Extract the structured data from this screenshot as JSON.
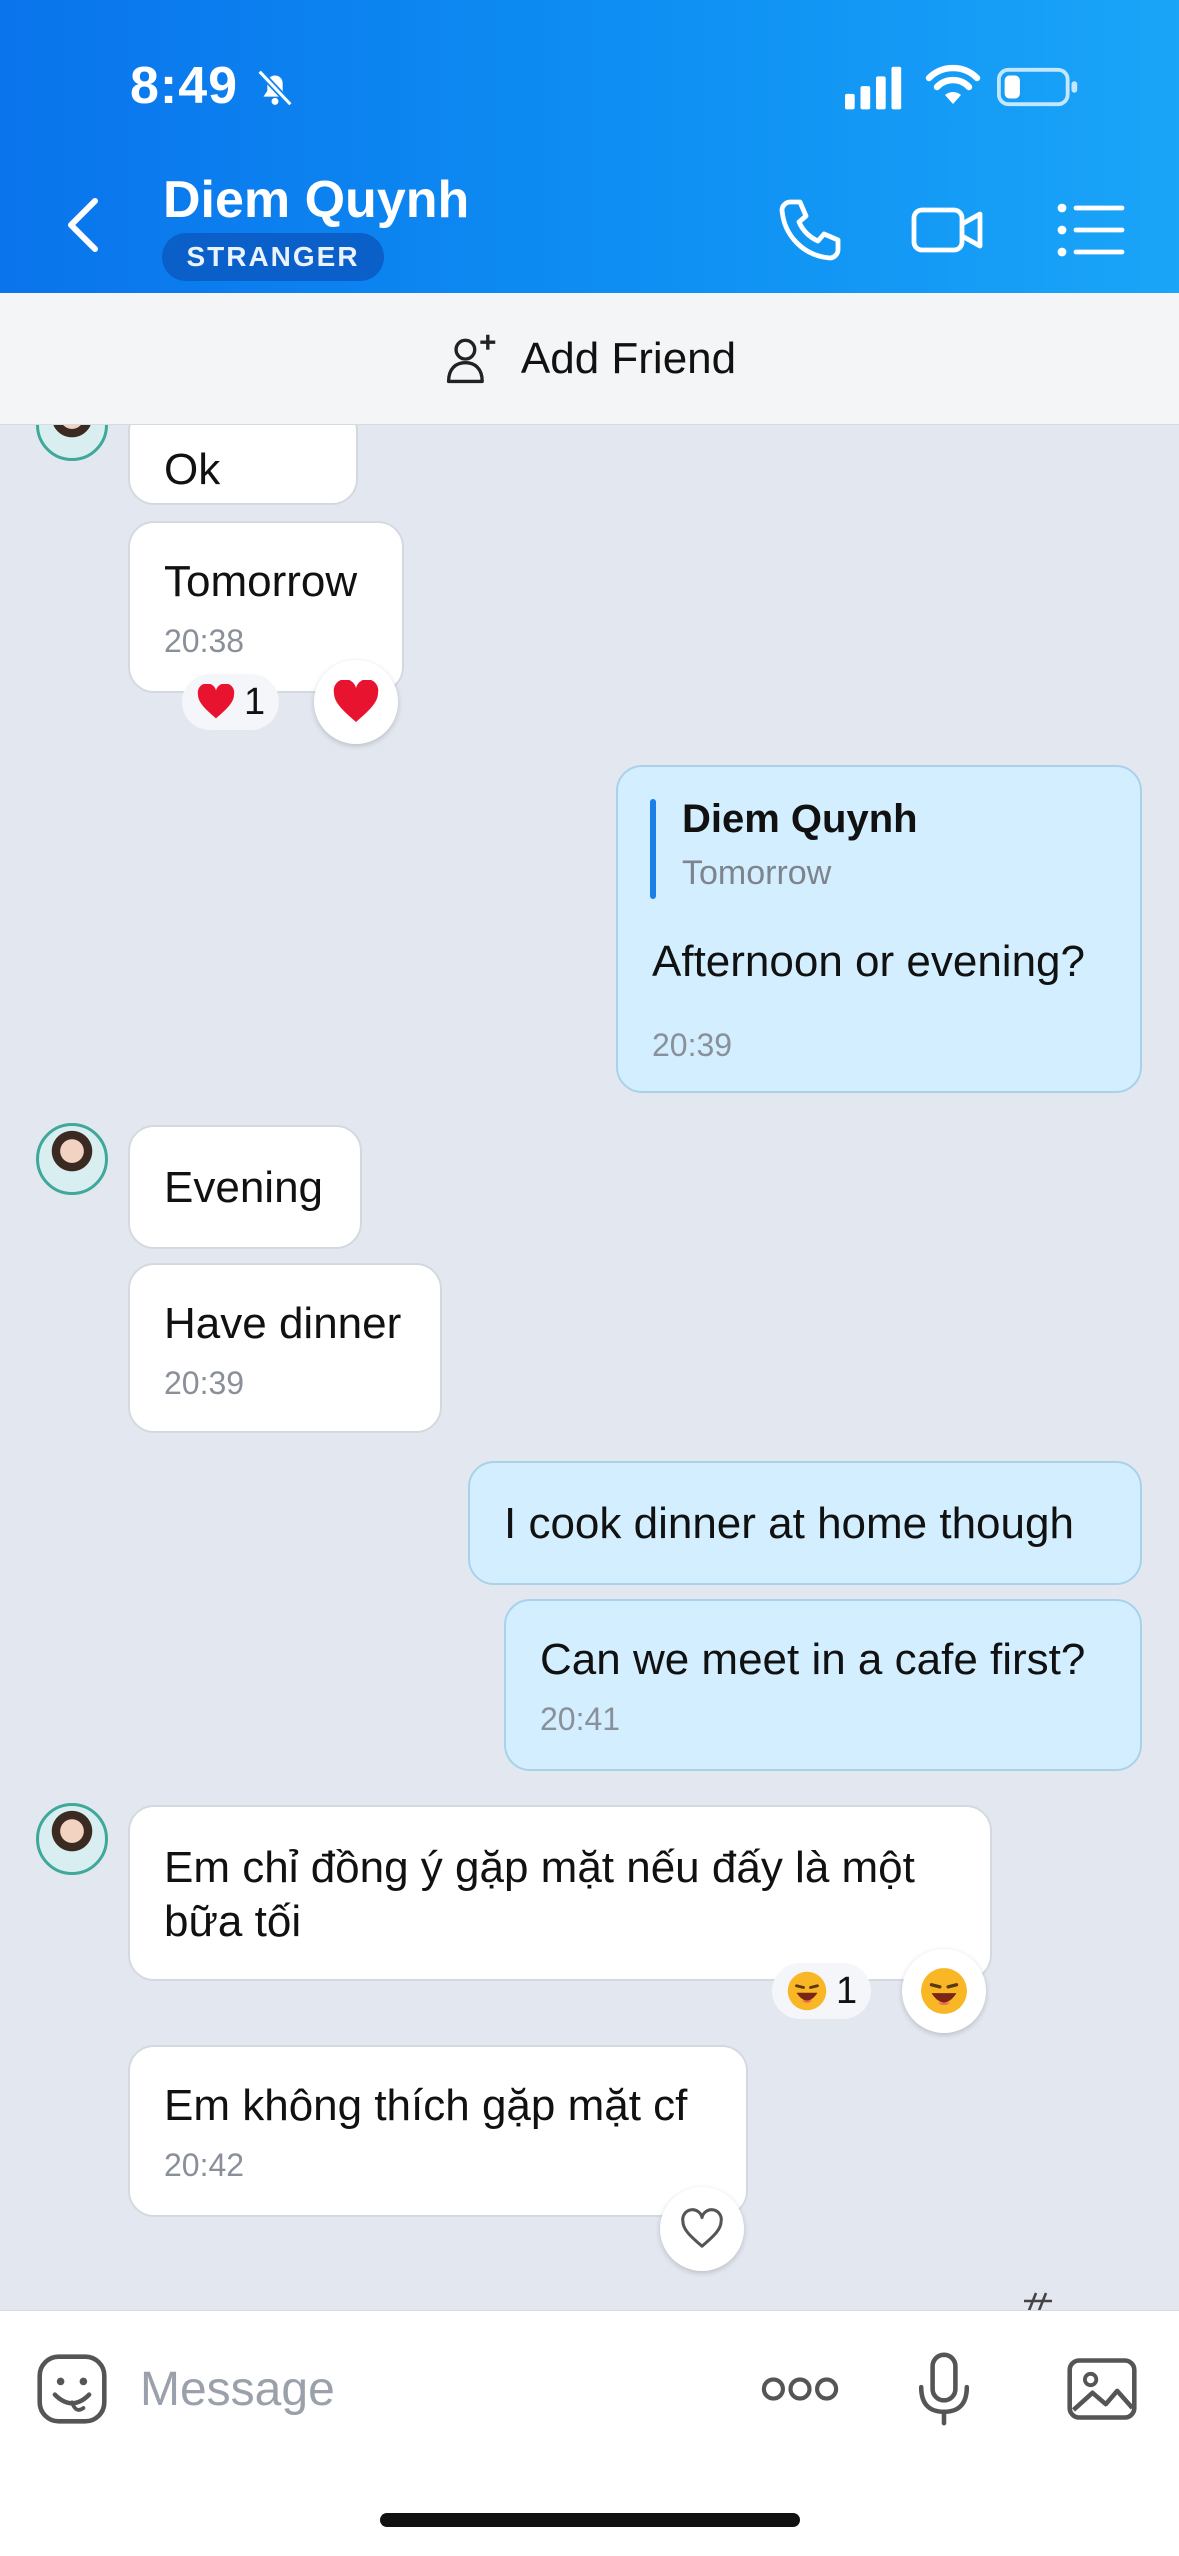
{
  "status_bar": {
    "time": "8:49"
  },
  "header": {
    "contact_name": "Diem Quynh",
    "badge": "STRANGER"
  },
  "friend_bar": {
    "label": "Add Friend"
  },
  "messages": [
    {
      "text": "Ok"
    },
    {
      "text": "Tomorrow",
      "time": "20:38",
      "reaction_count": "1"
    },
    {
      "reply_name": "Diem Quynh",
      "reply_text": "Tomorrow",
      "text": "Afternoon or evening?",
      "time": "20:39"
    },
    {
      "text": "Evening"
    },
    {
      "text": "Have dinner",
      "time": "20:39"
    },
    {
      "text": "I cook dinner at home though"
    },
    {
      "text": "Can we meet in a cafe first?",
      "time": "20:41"
    },
    {
      "text": "Em chỉ đồng ý gặp mặt nếu đấy là một bữa tối",
      "reaction_count": "1"
    },
    {
      "text": "Em không thích gặp mặt cf",
      "time": "20:42"
    }
  ],
  "composer": {
    "placeholder": "Message"
  },
  "colors": {
    "header_blue": "#0a74ec",
    "my_bubble": "#d3efff",
    "accent": "#1b7fe8"
  }
}
